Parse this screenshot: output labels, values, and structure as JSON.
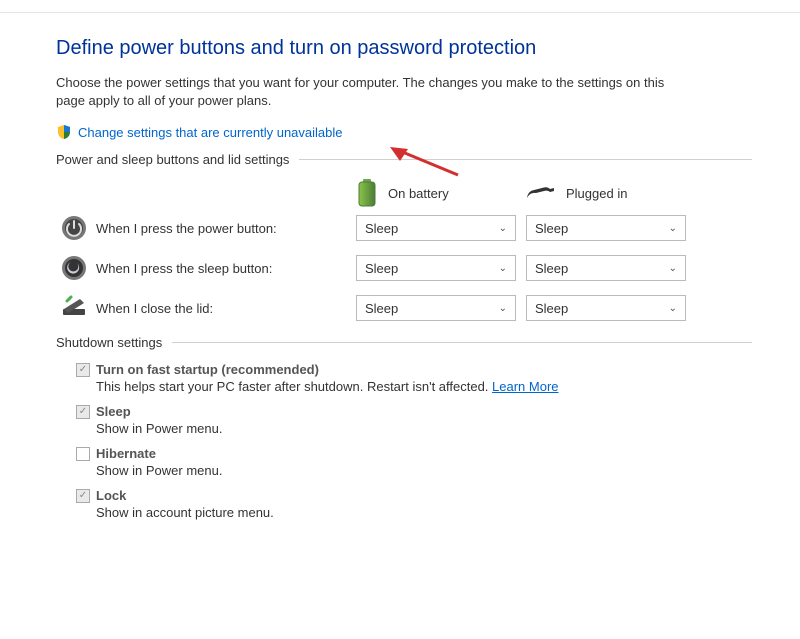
{
  "title": "Define power buttons and turn on password protection",
  "description": "Choose the power settings that you want for your computer. The changes you make to the settings on this page apply to all of your power plans.",
  "change_link": "Change settings that are currently unavailable",
  "group_buttons_header": "Power and sleep buttons and lid settings",
  "columns": {
    "battery": "On battery",
    "plugged": "Plugged in"
  },
  "rows": {
    "power_button": {
      "label": "When I press the power button:",
      "battery": "Sleep",
      "plugged": "Sleep"
    },
    "sleep_button": {
      "label": "When I press the sleep button:",
      "battery": "Sleep",
      "plugged": "Sleep"
    },
    "close_lid": {
      "label": "When I close the lid:",
      "battery": "Sleep",
      "plugged": "Sleep"
    }
  },
  "shutdown_header": "Shutdown settings",
  "shutdown": {
    "fast_startup": {
      "title": "Turn on fast startup (recommended)",
      "desc": "This helps start your PC faster after shutdown. Restart isn't affected. ",
      "learn_more": "Learn More",
      "checked": true
    },
    "sleep": {
      "title": "Sleep",
      "desc": "Show in Power menu.",
      "checked": true
    },
    "hibernate": {
      "title": "Hibernate",
      "desc": "Show in Power menu.",
      "checked": false
    },
    "lock": {
      "title": "Lock",
      "desc": "Show in account picture menu.",
      "checked": true
    }
  }
}
